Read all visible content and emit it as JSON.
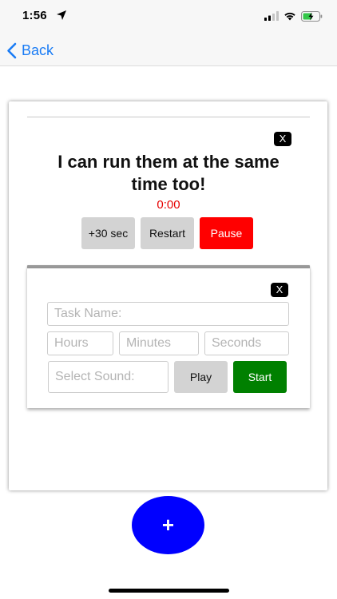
{
  "status_bar": {
    "time": "1:56",
    "icons": [
      "location-arrow-icon",
      "signal-icon",
      "wifi-icon",
      "battery-charging-icon"
    ]
  },
  "nav": {
    "back_label": "Back",
    "back_icon": "chevron-left-icon",
    "accent_color": "#1a7cf5"
  },
  "timer_card": {
    "close_label": "X",
    "title": "I can run them at the same time too!",
    "clock": "0:00",
    "buttons": {
      "add_30": "+30 sec",
      "restart": "Restart",
      "pause": "Pause"
    },
    "colors": {
      "clock": "#e60000",
      "pause": "#ff0000",
      "neutral": "#d3d3d3"
    }
  },
  "new_timer_form": {
    "close_label": "X",
    "task_name_placeholder": "Task Name:",
    "hours_placeholder": "Hours",
    "minutes_placeholder": "Minutes",
    "seconds_placeholder": "Seconds",
    "sound_placeholder": "Select Sound:",
    "play_label": "Play",
    "start_label": "Start",
    "colors": {
      "start": "#008000",
      "play": "#d3d3d3"
    }
  },
  "fab": {
    "label": "+",
    "color": "#0000ff"
  }
}
